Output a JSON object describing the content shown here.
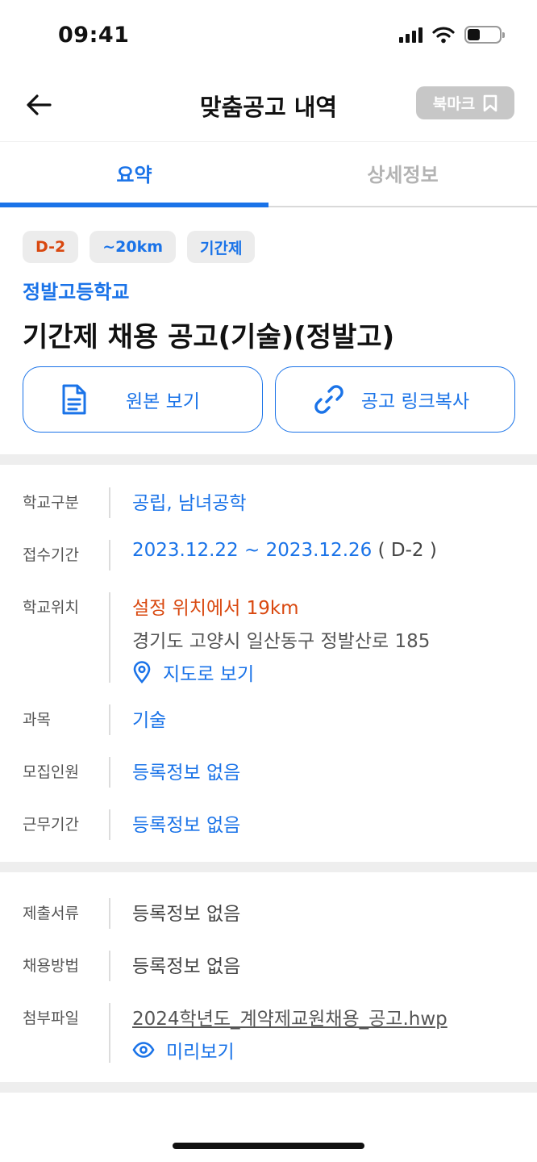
{
  "status_bar": {
    "time": "09:41"
  },
  "header": {
    "title": "맞춤공고 내역",
    "bookmark_label": "북마크"
  },
  "tabs": [
    {
      "label": "요약",
      "active": true
    },
    {
      "label": "상세정보",
      "active": false
    }
  ],
  "summary": {
    "chips": [
      "D-2",
      "~20km",
      "기간제"
    ],
    "school_name": "정발고등학교",
    "title": "기간제 채용 공고(기술)(정발고)",
    "buttons": {
      "original": "원본 보기",
      "copy_link": "공고 링크복사"
    }
  },
  "info": {
    "school_type": {
      "label": "학교구분",
      "value": "공립, 남녀공학"
    },
    "application_period": {
      "label": "접수기간",
      "value": "2023.12.22 ~ 2023.12.26",
      "dday": "( D-2 )"
    },
    "location": {
      "label": "학교위치",
      "distance": "설정 위치에서 19km",
      "address": "경기도 고양시 일산동구 정발산로 185",
      "map_link": "지도로 보기"
    },
    "subject": {
      "label": "과목",
      "value": "기술"
    },
    "recruit_count": {
      "label": "모집인원",
      "value": "등록정보 없음"
    },
    "work_period": {
      "label": "근무기간",
      "value": "등록정보 없음"
    }
  },
  "documents": {
    "submission": {
      "label": "제출서류",
      "value": "등록정보 없음"
    },
    "hiring_method": {
      "label": "채용방법",
      "value": "등록정보 없음"
    },
    "attachment": {
      "label": "첨부파일",
      "file_name": "2024학년도_계약제교원채용_공고.hwp",
      "preview": "미리보기"
    }
  },
  "colors": {
    "accent": "#1a73e8",
    "dday": "#d9480f",
    "chip_bg": "#ececec",
    "bookmark_bg": "#c7c7c7"
  }
}
